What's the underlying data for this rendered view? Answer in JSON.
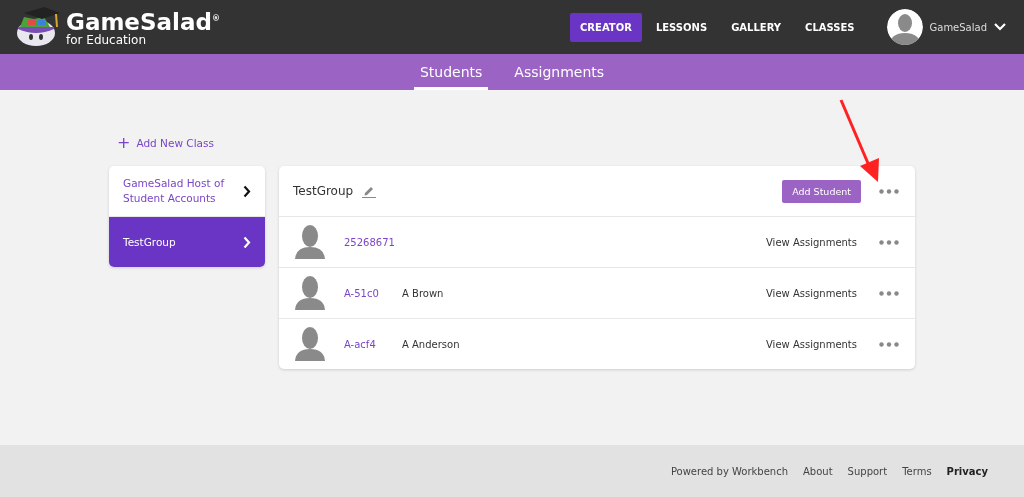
{
  "brand": {
    "name": "GameSalad",
    "mark": "®",
    "subtitle": "for Education"
  },
  "nav": [
    {
      "label": "CREATOR",
      "selected": true
    },
    {
      "label": "LESSONS",
      "selected": false
    },
    {
      "label": "GALLERY",
      "selected": false
    },
    {
      "label": "CLASSES",
      "selected": false
    }
  ],
  "user": {
    "name": "GameSalad"
  },
  "subnav": [
    {
      "label": "Students",
      "selected": true
    },
    {
      "label": "Assignments",
      "selected": false
    }
  ],
  "add_class": {
    "icon": "+",
    "label": "Add New Class"
  },
  "classes": [
    {
      "label": "GameSalad Host of Student Accounts",
      "selected": false
    },
    {
      "label": "TestGroup",
      "selected": true
    }
  ],
  "group": {
    "title": "TestGroup",
    "add_button": "Add Student"
  },
  "students": [
    {
      "id": "25268671",
      "action": "View Assignments"
    },
    {
      "id": "A-51c0",
      "name": "A Brown",
      "action": "View Assignments"
    },
    {
      "id": "A-acf4",
      "name": "A Anderson",
      "action": "View Assignments"
    }
  ],
  "footer": [
    {
      "label": "Powered by Workbench",
      "bold": false
    },
    {
      "label": "About",
      "bold": false
    },
    {
      "label": "Support",
      "bold": false
    },
    {
      "label": "Terms",
      "bold": false
    },
    {
      "label": "Privacy",
      "bold": true
    }
  ]
}
